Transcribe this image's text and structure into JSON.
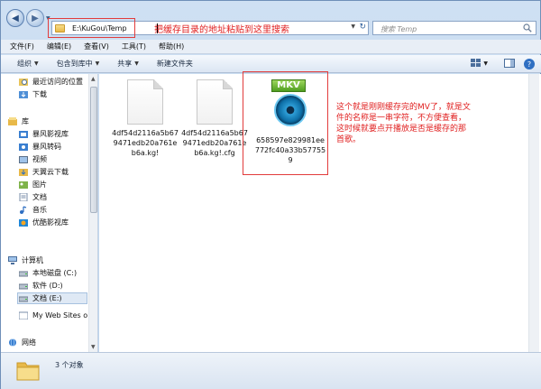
{
  "address_bar": {
    "path": "E:\\KuGou\\Temp",
    "annotation": "把缓存目录的地址粘贴到这里搜索"
  },
  "search": {
    "placeholder": "搜索 Temp"
  },
  "menu": {
    "items": [
      {
        "label": "文件(F)"
      },
      {
        "label": "编辑(E)"
      },
      {
        "label": "查看(V)"
      },
      {
        "label": "工具(T)"
      },
      {
        "label": "帮助(H)"
      }
    ]
  },
  "toolbar": {
    "organize": "组织",
    "include_library": "包含到库中",
    "share": "共享",
    "new_folder": "新建文件夹"
  },
  "nav_pane": {
    "items": [
      {
        "label": "最近访问的位置",
        "icon": "recent-places-icon"
      },
      {
        "label": "下载",
        "icon": "download-folder-icon"
      },
      {
        "label": "库",
        "icon": "library-icon"
      },
      {
        "label": "暴风影视库",
        "icon": "video-library-icon"
      },
      {
        "label": "暴风转码",
        "icon": "transcode-icon"
      },
      {
        "label": "视频",
        "icon": "video-icon"
      },
      {
        "label": "天翼云下载",
        "icon": "cloud-download-icon"
      },
      {
        "label": "图片",
        "icon": "pictures-icon"
      },
      {
        "label": "文档",
        "icon": "documents-icon"
      },
      {
        "label": "音乐",
        "icon": "music-icon"
      },
      {
        "label": "优酷影视库",
        "icon": "youku-library-icon"
      },
      {
        "label": "计算机",
        "icon": "computer-icon"
      },
      {
        "label": "本地磁盘 (C:)",
        "icon": "drive-icon"
      },
      {
        "label": "软件 (D:)",
        "icon": "drive-icon"
      },
      {
        "label": "文档 (E:)",
        "icon": "drive-icon"
      },
      {
        "label": "My Web Sites o",
        "icon": "web-folder-icon"
      },
      {
        "label": "网络",
        "icon": "network-icon"
      }
    ]
  },
  "files": [
    {
      "name": "4df54d2116a5b679471edb20a761eb6a.kg!",
      "icon": "blank-file-icon"
    },
    {
      "name": "4df54d2116a5b679471edb20a761eb6a.kg!.cfg",
      "icon": "blank-file-icon"
    },
    {
      "name": "658597e829981ee772fc40a33b577559",
      "icon": "mkv-file-icon",
      "badge": "MKV"
    }
  ],
  "annotation_mkv": "这个就是刚刚缓存完的MV了，就是文件的名称是一串字符，不方便查看，这时候就要点开播放是否是缓存的那首歌。",
  "status": {
    "count": "3 个对象"
  },
  "colors": {
    "annotation_red": "#e02020",
    "selection_blue": "#dfe9f5",
    "mkv_green": "#4f9e20"
  }
}
